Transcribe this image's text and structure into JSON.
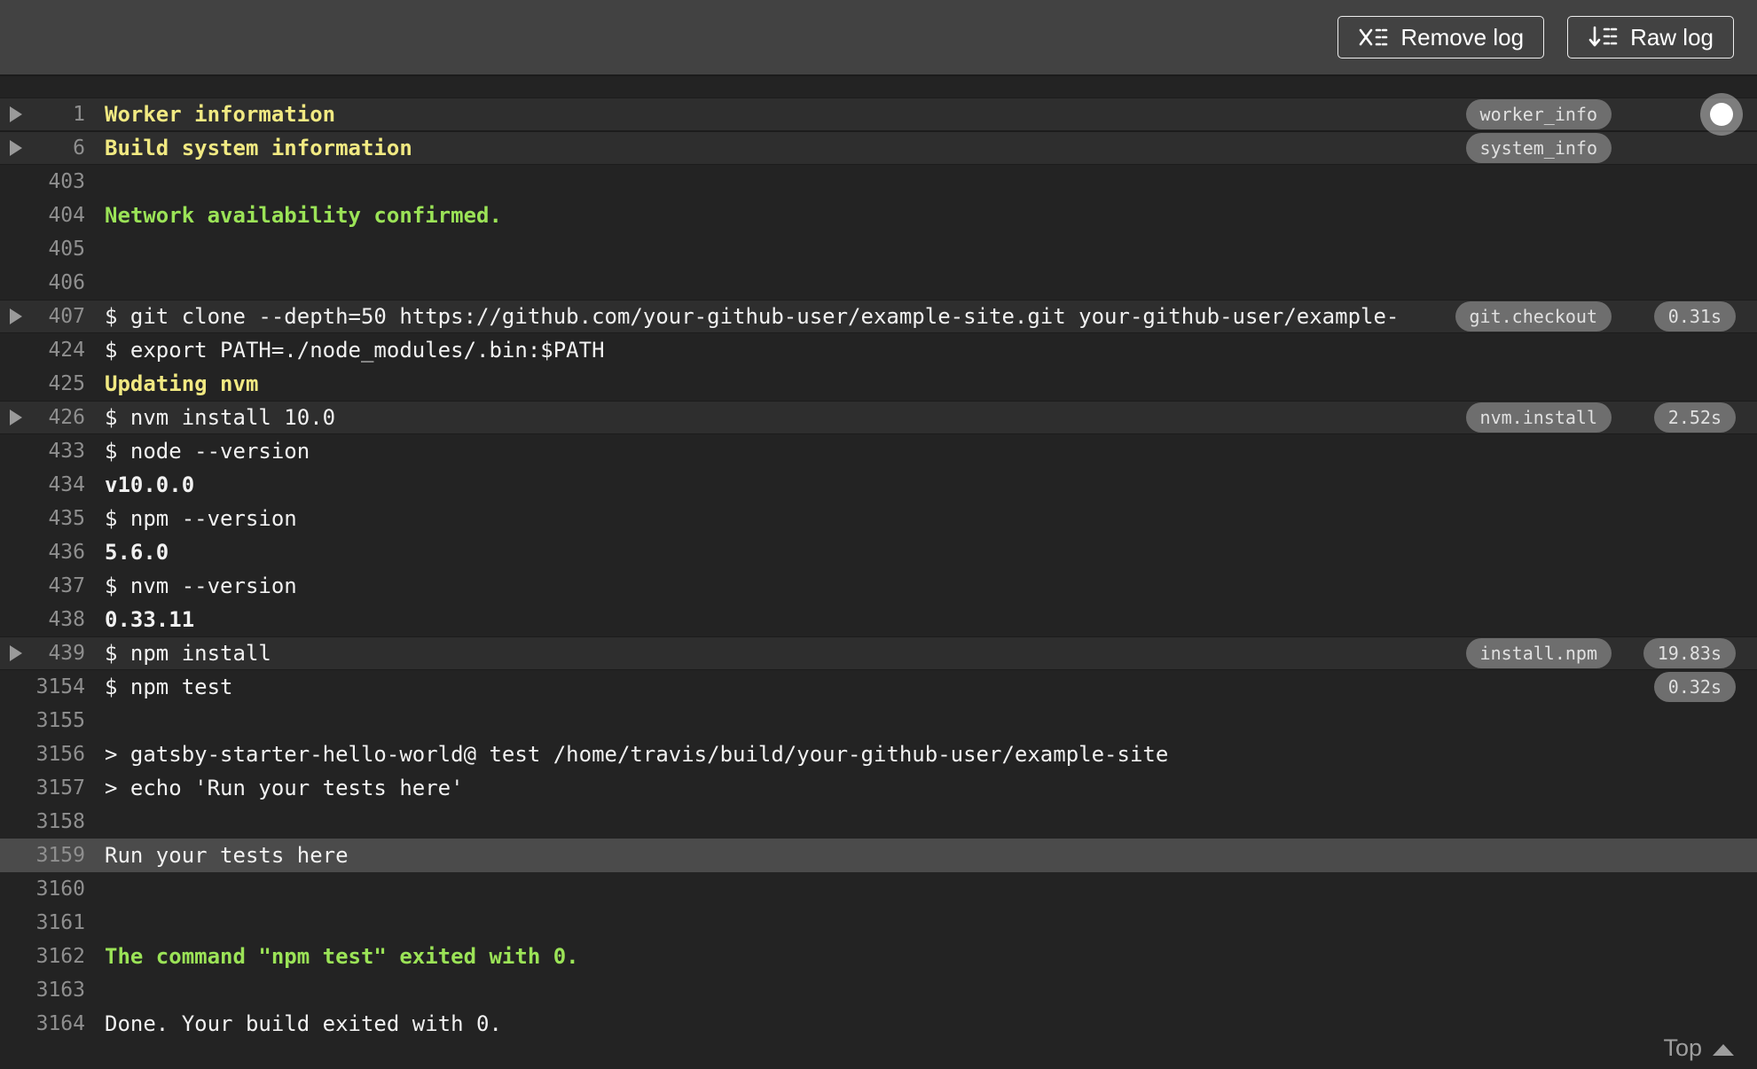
{
  "toolbar": {
    "remove_log_label": "Remove log",
    "raw_log_label": "Raw log"
  },
  "scroll": {
    "top_label": "Top"
  },
  "colors": {
    "topbar_bg": "#424242",
    "log_bg": "#232323",
    "fold_header_bg": "#2e2e2e",
    "selected_row_bg": "#4b4b4b",
    "text": "#f1f1f1",
    "line_number": "#8f8f8f",
    "fold_title_yellow": "#f1e982",
    "success_green": "#9be357",
    "badge_bg": "#6e6e6e",
    "badge_text": "#e0e0e0"
  },
  "log": {
    "lines": [
      {
        "num": "1",
        "text": "Worker information",
        "style": "title",
        "fold": true,
        "badge": "worker_info"
      },
      {
        "num": "6",
        "text": "Build system information",
        "style": "title",
        "fold": true,
        "badge": "system_info"
      },
      {
        "num": "403",
        "text": ""
      },
      {
        "num": "404",
        "text": "Network availability confirmed.",
        "style": "success"
      },
      {
        "num": "405",
        "text": ""
      },
      {
        "num": "406",
        "text": ""
      },
      {
        "num": "407",
        "text": "$ git clone --depth=50 https://github.com/your-github-user/example-site.git your-github-user/example-",
        "fold": true,
        "badge": "git.checkout",
        "timer": "0.31s"
      },
      {
        "num": "424",
        "text": "$ export PATH=./node_modules/.bin:$PATH"
      },
      {
        "num": "425",
        "text": "Updating nvm",
        "style": "title"
      },
      {
        "num": "426",
        "text": "$ nvm install 10.0",
        "fold": true,
        "badge": "nvm.install",
        "timer": "2.52s"
      },
      {
        "num": "433",
        "text": "$ node --version"
      },
      {
        "num": "434",
        "text": "v10.0.0",
        "style": "bold"
      },
      {
        "num": "435",
        "text": "$ npm --version"
      },
      {
        "num": "436",
        "text": "5.6.0",
        "style": "bold"
      },
      {
        "num": "437",
        "text": "$ nvm --version"
      },
      {
        "num": "438",
        "text": "0.33.11",
        "style": "bold"
      },
      {
        "num": "439",
        "text": "$ npm install",
        "fold": true,
        "badge": "install.npm",
        "timer": "19.83s"
      },
      {
        "num": "3154",
        "text": "$ npm test",
        "timer": "0.32s"
      },
      {
        "num": "3155",
        "text": ""
      },
      {
        "num": "3156",
        "text": "> gatsby-starter-hello-world@ test /home/travis/build/your-github-user/example-site"
      },
      {
        "num": "3157",
        "text": "> echo 'Run your tests here'"
      },
      {
        "num": "3158",
        "text": ""
      },
      {
        "num": "3159",
        "text": "Run your tests here",
        "selected": true
      },
      {
        "num": "3160",
        "text": ""
      },
      {
        "num": "3161",
        "text": ""
      },
      {
        "num": "3162",
        "text": "The command \"npm test\" exited with 0.",
        "style": "success"
      },
      {
        "num": "3163",
        "text": ""
      },
      {
        "num": "3164",
        "text": "Done. Your build exited with 0."
      }
    ]
  }
}
